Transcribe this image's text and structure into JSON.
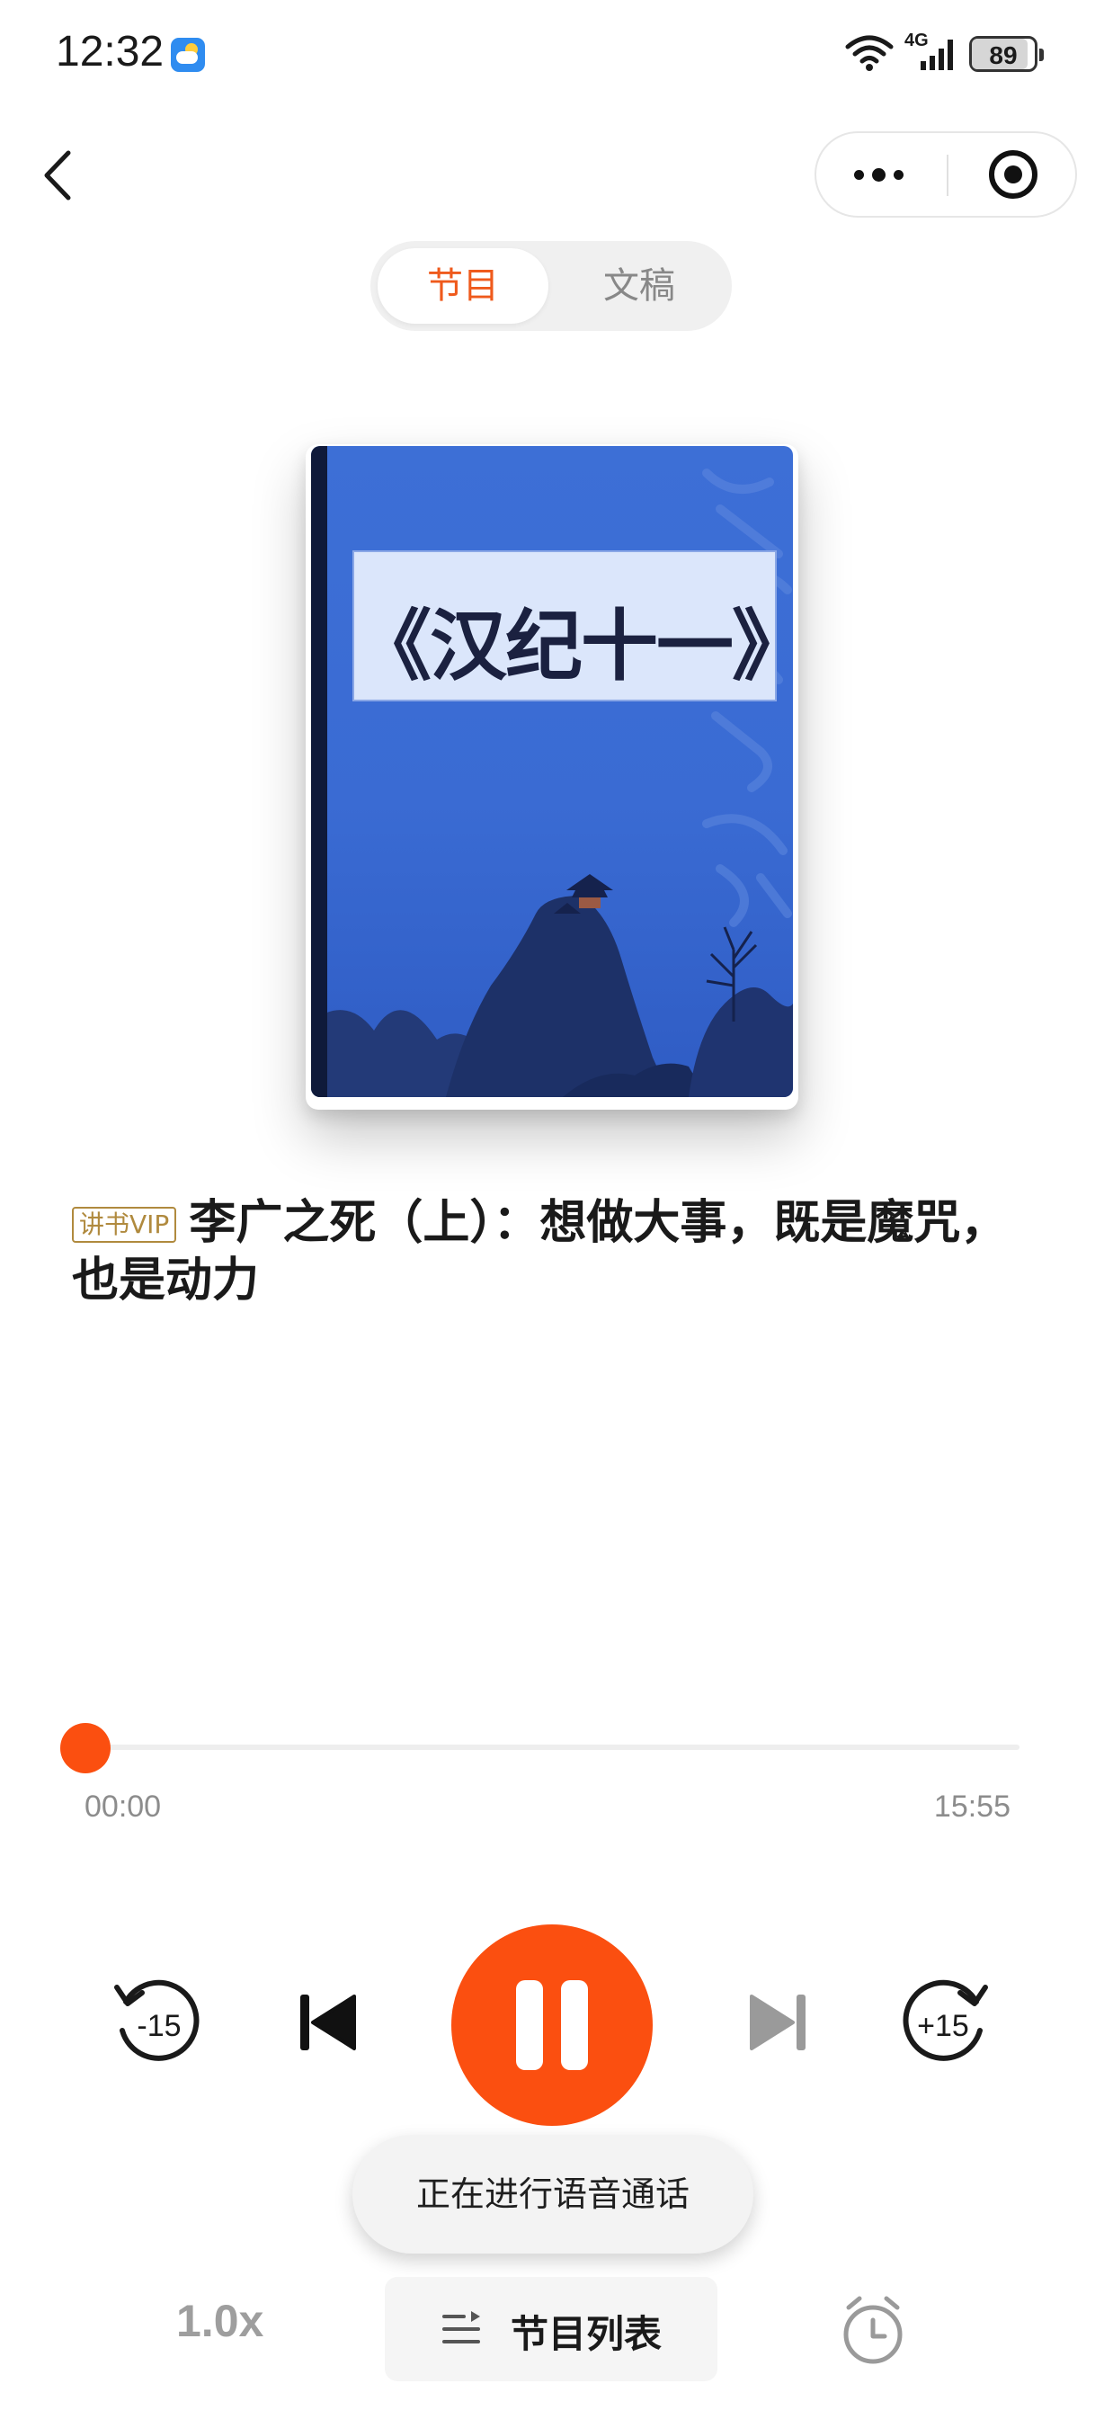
{
  "status_bar": {
    "time": "12:32",
    "network": "4G",
    "battery": "89",
    "battery_level": 0.89
  },
  "tabs": [
    {
      "label": "节目",
      "active": true
    },
    {
      "label": "文稿",
      "active": false
    }
  ],
  "cover": {
    "title": "《汉纪十一》"
  },
  "episode": {
    "badge": "讲书VIP",
    "title": "李广之死（上）：想做大事，既是魔咒，也是动力"
  },
  "progress": {
    "current": "00:00",
    "total": "15:55",
    "fraction": 0.0
  },
  "controls": {
    "rewind": "-15",
    "forward": "+15"
  },
  "toast": "正在进行语音通话",
  "bottom_bar": {
    "speed": "1.0x",
    "playlist_label": "节目列表"
  },
  "colors": {
    "accent": "#fb4f10",
    "tab_active": "#ef5a1c",
    "vip_gold": "#b08a3e",
    "cover_blue": "#3d6fd6"
  }
}
